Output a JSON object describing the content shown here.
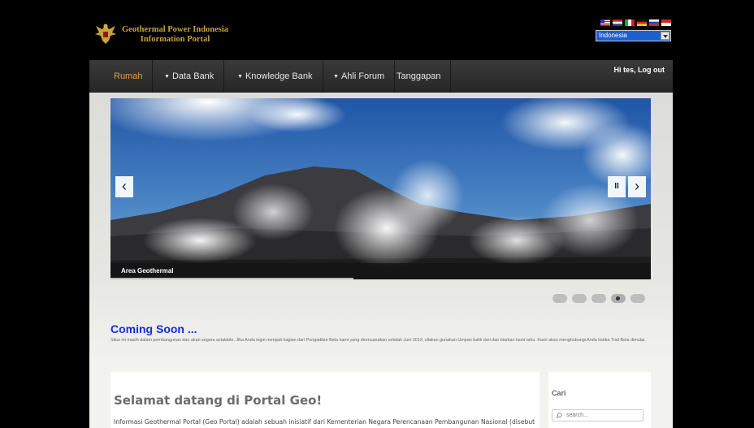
{
  "header": {
    "site_title_line1": "Geothermal Power Indonesia",
    "site_title_line2": "Information Portal",
    "language": {
      "selected": "Indonesia",
      "flags": [
        "flag-us",
        "flag-nl",
        "flag-it",
        "flag-de",
        "flag-ru",
        "flag-id"
      ]
    }
  },
  "nav": {
    "items": [
      {
        "label": "Rumah",
        "dropdown": false,
        "active": true
      },
      {
        "label": "Data Bank",
        "dropdown": true
      },
      {
        "label": "Knowledge Bank",
        "dropdown": true
      },
      {
        "label": "Ahli Forum",
        "dropdown": true
      },
      {
        "label": "Tanggapan",
        "dropdown": false
      }
    ],
    "user_text": "Hi tes, Log out"
  },
  "slider": {
    "caption": "Area Geothermal",
    "prev_icon": "‹",
    "next_icon": "›",
    "pause_icon": "II",
    "slide_count": 5,
    "active_slide": 4
  },
  "notice": {
    "title": "Coming Soon ...",
    "text": "Situs ini masih dalam pembangunan dan akan segera avialable. Jika Anda ingin menjadi bagian dari Pengadilan Beta kami yang direncanakan setelah Juni 2013, silakan gunakan Umpan balik dari dan biarkan kami tahu. Kami akan menghubungi Anda ketika Trail Beta dimulai."
  },
  "welcome": {
    "title": "Selamat datang di Portal Geo!",
    "text": "Informasi Geothermal Portal (Geo Portal) adalah sebuah inisiatif dari Kementerian Negara Perencanaan Pembangunan Nasional (disebut dalam bahasa Indonesia sebagai \"BAPPENAS\") untuk memberikan up to date"
  },
  "sidebar": {
    "search_title": "Cari",
    "search_placeholder": "search..."
  },
  "colors": {
    "background": "#000000",
    "nav_active": "#e0a040",
    "notice_title": "#1a2ad8",
    "logo_gold": "#c9a23a",
    "language_select": "#1e5fcf"
  }
}
